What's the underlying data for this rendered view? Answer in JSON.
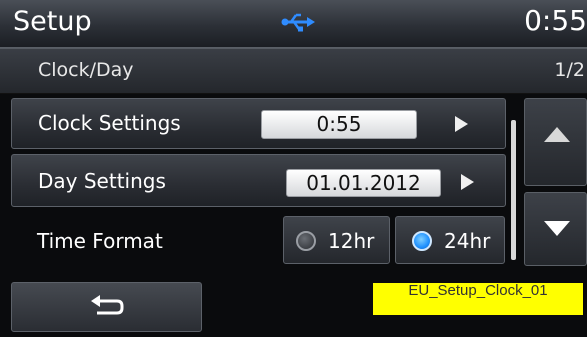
{
  "header": {
    "title": "Setup",
    "time": "0:55",
    "status_icon": "usb-icon"
  },
  "subheader": {
    "breadcrumb": "Clock/Day",
    "page": "1/2"
  },
  "rows": {
    "clock": {
      "label": "Clock Settings",
      "value": "0:55"
    },
    "day": {
      "label": "Day Settings",
      "value": "01.01.2012"
    },
    "format": {
      "label": "Time Format",
      "option_12": "12hr",
      "option_24": "24hr",
      "selected": "24hr"
    }
  },
  "nav": {
    "up_icon": "triangle-up-icon",
    "down_icon": "triangle-down-icon",
    "back_icon": "back-arrow-icon"
  },
  "annotation": {
    "text": "EU_Setup_Clock_01"
  },
  "colors": {
    "accent": "#1e90ff",
    "annotation_bg": "#ffff00",
    "usb": "#2f8cff"
  }
}
